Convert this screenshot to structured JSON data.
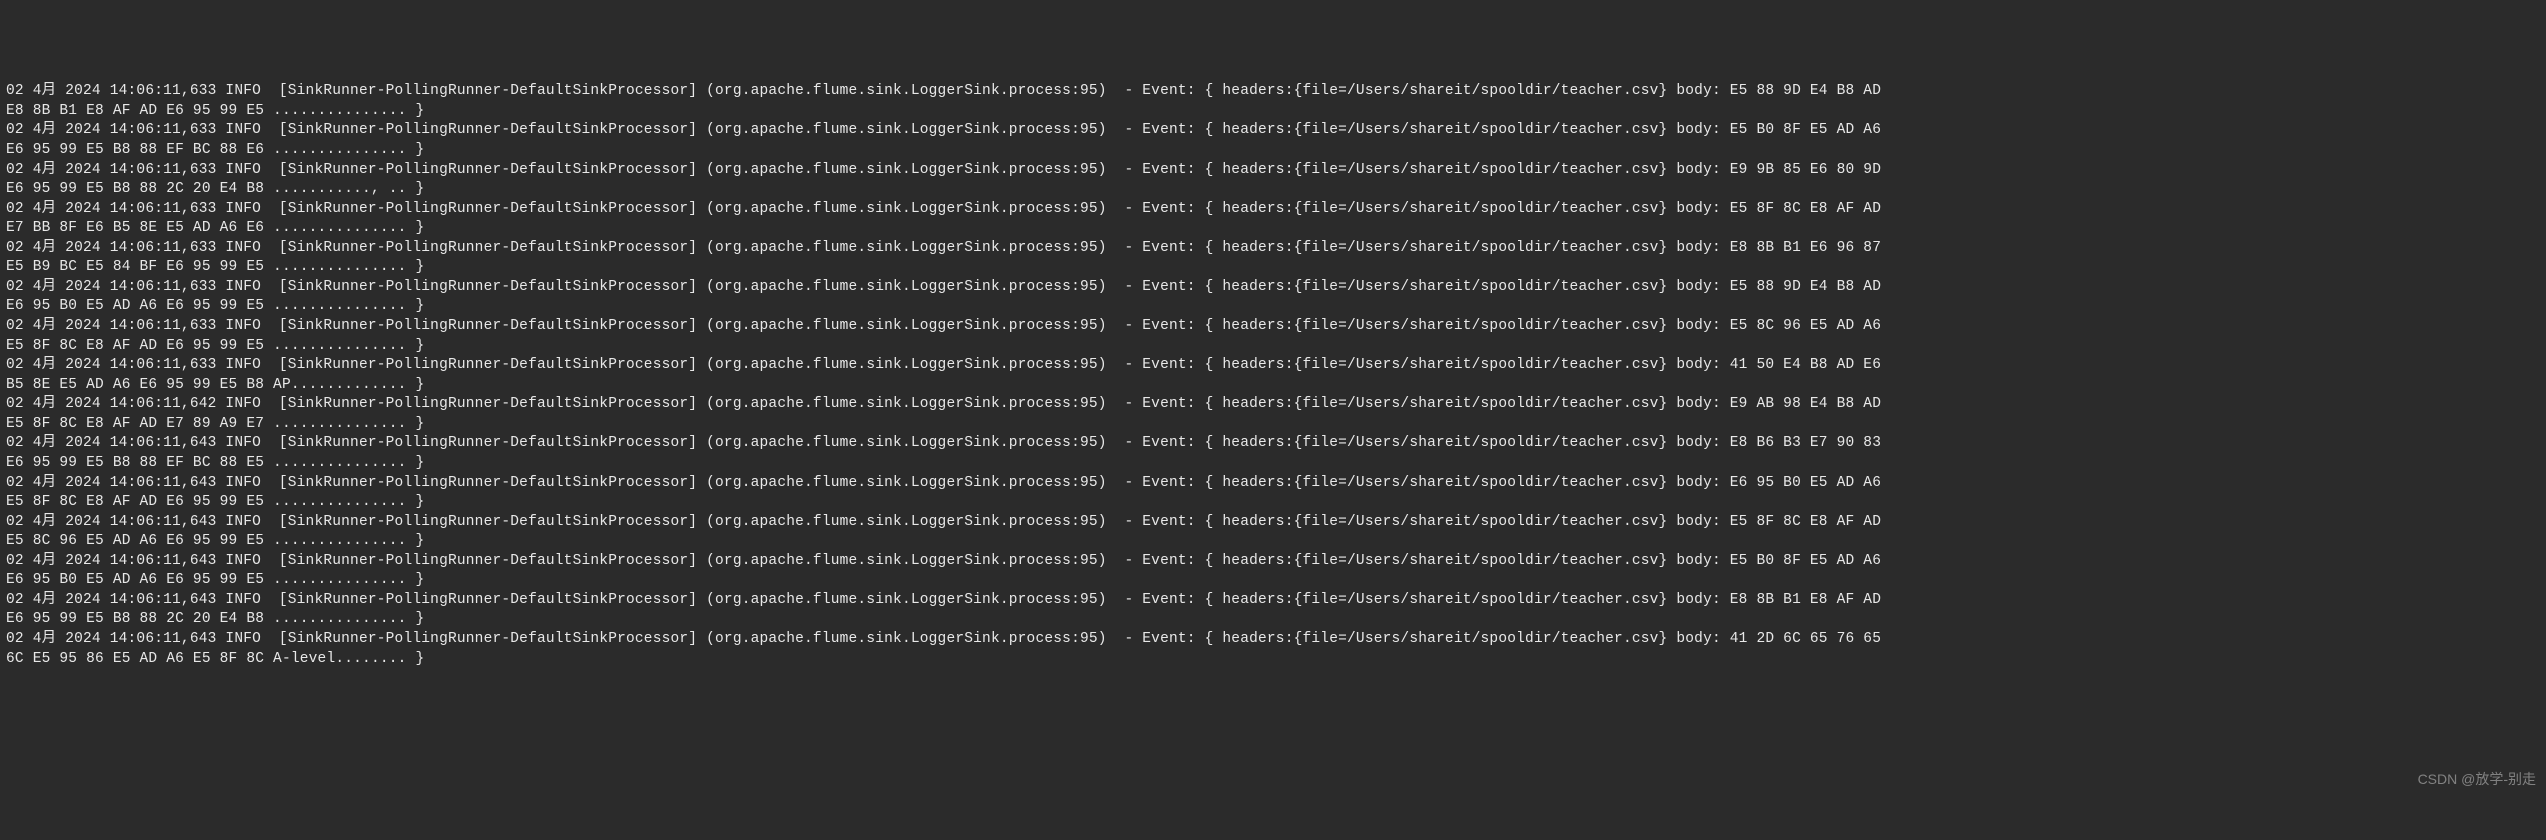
{
  "watermark": "CSDN @放学-别走",
  "log": {
    "common": {
      "date": "02 4月 2024",
      "level": "INFO",
      "thread": "[SinkRunner-PollingRunner-DefaultSinkProcessor]",
      "source": "(org.apache.flume.sink.LoggerSink.process:95)",
      "prefix": "- Event: { headers:{file=/Users/shareit/spooldir/teacher.csv} body:"
    },
    "lines": [
      {
        "time": "14:06:11,633",
        "body1": "E5 88 9D E4 B8 AD",
        "body2": "E8 8B B1 E8 AF AD E6 95 99 E5 ............... }"
      },
      {
        "time": "14:06:11,633",
        "body1": "E5 B0 8F E5 AD A6",
        "body2": "E6 95 99 E5 B8 88 EF BC 88 E6 ............... }"
      },
      {
        "time": "14:06:11,633",
        "body1": "E9 9B 85 E6 80 9D",
        "body2": "E6 95 99 E5 B8 88 2C 20 E4 B8 ..........., .. }"
      },
      {
        "time": "14:06:11,633",
        "body1": "E5 8F 8C E8 AF AD",
        "body2": "E7 BB 8F E6 B5 8E E5 AD A6 E6 ............... }"
      },
      {
        "time": "14:06:11,633",
        "body1": "E8 8B B1 E6 96 87",
        "body2": "E5 B9 BC E5 84 BF E6 95 99 E5 ............... }"
      },
      {
        "time": "14:06:11,633",
        "body1": "E5 88 9D E4 B8 AD",
        "body2": "E6 95 B0 E5 AD A6 E6 95 99 E5 ............... }"
      },
      {
        "time": "14:06:11,633",
        "body1": "E5 8C 96 E5 AD A6",
        "body2": "E5 8F 8C E8 AF AD E6 95 99 E5 ............... }"
      },
      {
        "time": "14:06:11,633",
        "body1": "41 50 E4 B8 AD E6",
        "body2": "B5 8E E5 AD A6 E6 95 99 E5 B8 AP............. }"
      },
      {
        "time": "14:06:11,642",
        "body1": "E9 AB 98 E4 B8 AD",
        "body2": "E5 8F 8C E8 AF AD E7 89 A9 E7 ............... }"
      },
      {
        "time": "14:06:11,643",
        "body1": "E8 B6 B3 E7 90 83",
        "body2": "E6 95 99 E5 B8 88 EF BC 88 E5 ............... }"
      },
      {
        "time": "14:06:11,643",
        "body1": "E6 95 B0 E5 AD A6",
        "body2": "E5 8F 8C E8 AF AD E6 95 99 E5 ............... }"
      },
      {
        "time": "14:06:11,643",
        "body1": "E5 8F 8C E8 AF AD",
        "body2": "E5 8C 96 E5 AD A6 E6 95 99 E5 ............... }"
      },
      {
        "time": "14:06:11,643",
        "body1": "E5 B0 8F E5 AD A6",
        "body2": "E6 95 B0 E5 AD A6 E6 95 99 E5 ............... }"
      },
      {
        "time": "14:06:11,643",
        "body1": "E8 8B B1 E8 AF AD",
        "body2": "E6 95 99 E5 B8 88 2C 20 E4 B8 ............... }"
      },
      {
        "time": "14:06:11,643",
        "body1": "41 2D 6C 65 76 65",
        "body2": "6C E5 95 86 E5 AD A6 E5 8F 8C A-level........ }"
      }
    ]
  }
}
